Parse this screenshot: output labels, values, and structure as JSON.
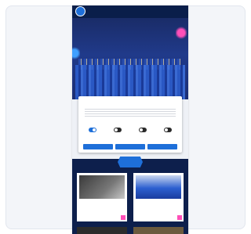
{
  "nav": {
    "items": [
      "",
      "",
      "",
      "",
      "",
      ""
    ]
  },
  "hero": {
    "title": ""
  },
  "consent": {
    "brand": "",
    "title": "",
    "toggles": [
      {
        "label": "",
        "on": true
      },
      {
        "label": "",
        "on": false
      },
      {
        "label": "",
        "on": false
      },
      {
        "label": "",
        "on": false
      }
    ],
    "details_link": "",
    "buttons": [
      "",
      "",
      ""
    ]
  },
  "news": {
    "section_label": "",
    "articles": [
      {
        "title": ""
      },
      {
        "title": ""
      }
    ]
  },
  "colors": {
    "brand_blue": "#1e6fd9",
    "navy": "#0a1e4a",
    "accent_pink": "#ff4fb8"
  }
}
